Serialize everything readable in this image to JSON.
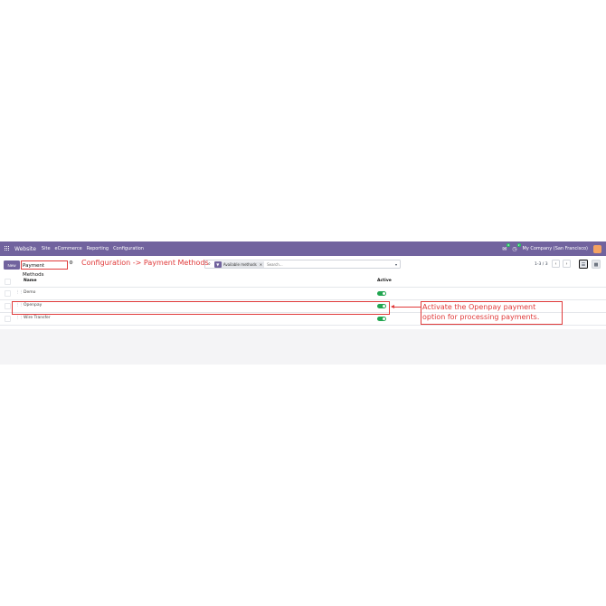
{
  "navbar": {
    "brand": "Website",
    "menu": [
      "Site",
      "eCommerce",
      "Reporting",
      "Configuration"
    ],
    "chat_badge": "6",
    "activity_badge": "2",
    "company": "My Company (San Francisco)"
  },
  "control": {
    "new_label": "New",
    "breadcrumb": "Payment Methods",
    "pager": "1-3 / 3"
  },
  "search": {
    "facet": "Available methods",
    "placeholder": "Search..."
  },
  "table": {
    "headers": {
      "name": "Name",
      "active": "Active"
    },
    "rows": [
      {
        "name": "Demo",
        "active": true
      },
      {
        "name": "Openpay",
        "active": true
      },
      {
        "name": "Wire Transfer",
        "active": true
      }
    ]
  },
  "annotations": {
    "path": "Configuration -> Payment Methods",
    "callout": "Activate the Openpay payment option for processing payments."
  },
  "colors": {
    "brand": "#71639e",
    "annotation": "#e03a3a",
    "toggle_on": "#22a651"
  }
}
